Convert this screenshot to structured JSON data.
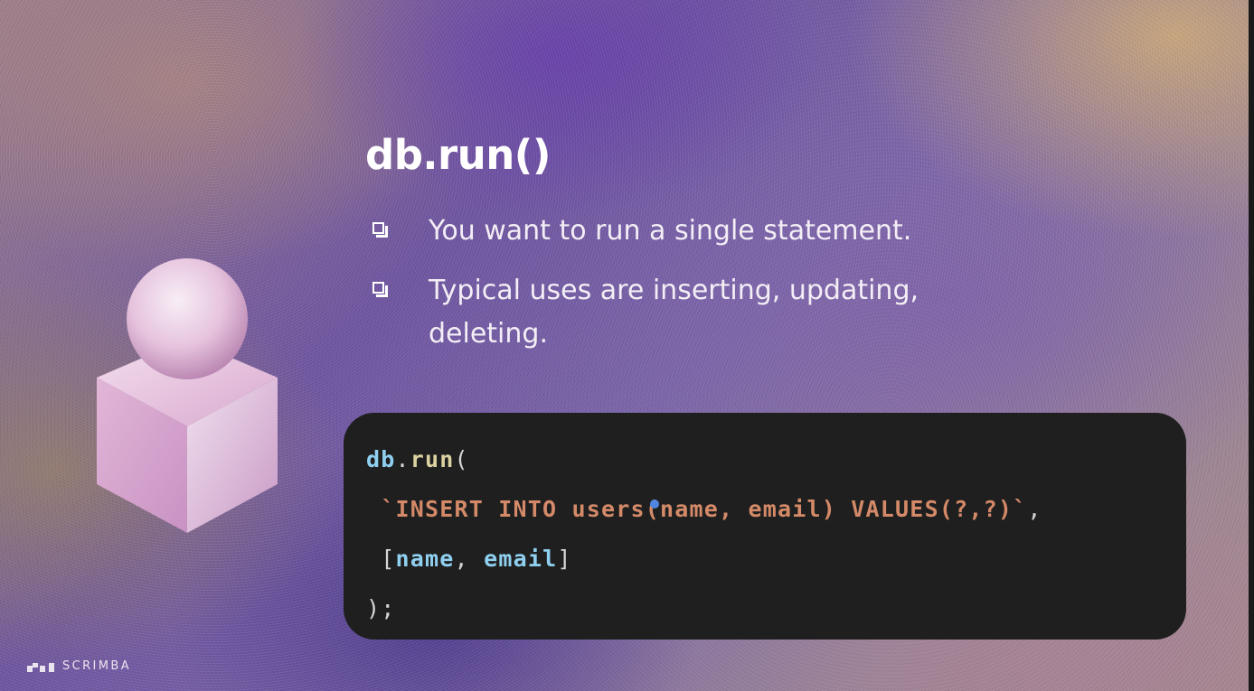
{
  "slide": {
    "title": "db.run()",
    "bullets": [
      "You want to run a single statement.",
      "Typical uses are inserting, updating, deleting."
    ]
  },
  "code": {
    "line1": {
      "obj": "db",
      "dot": ".",
      "fn": "run",
      "paren": "("
    },
    "line2": {
      "indent": " ",
      "string": "`INSERT INTO users(name, email) VALUES(?,?)`",
      "comma": ","
    },
    "line3": {
      "indent": " ",
      "open": "[",
      "arg1": "name",
      "sep": ", ",
      "arg2": "email",
      "close": "]"
    },
    "line4": {
      "text": ");"
    }
  },
  "colors": {
    "code_background": "#1f1f1f",
    "code_object": "#8fd0f0",
    "code_function": "#dcd3a2",
    "code_string": "#d48a68",
    "cursor": "#4f86e0"
  },
  "icons": {
    "bullet": "checkbox-bullet-icon",
    "illustration": "sphere-on-cube-illustration",
    "brand": "scrimba-logo-icon"
  },
  "brand": {
    "name": "SCRIMBA"
  }
}
